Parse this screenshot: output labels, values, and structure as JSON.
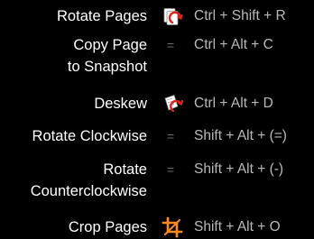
{
  "shortcuts": [
    {
      "label_lines": [
        "Rotate Pages"
      ],
      "icon": "rotate-pages-icon",
      "separator": "",
      "keys": "Ctrl + Shift + R"
    },
    {
      "label_lines": [
        "Copy Page",
        "to Snapshot"
      ],
      "icon": "",
      "separator": "=",
      "keys": "Ctrl + Alt + C"
    },
    {
      "label_lines": [
        "Deskew"
      ],
      "icon": "deskew-icon",
      "separator": "",
      "keys": "Ctrl + Alt + D"
    },
    {
      "label_lines": [
        "Rotate Clockwise"
      ],
      "icon": "",
      "separator": "=",
      "keys": "Shift + Alt + (=)"
    },
    {
      "label_lines": [
        "Rotate",
        "Counterclockwise"
      ],
      "icon": "",
      "separator": "=",
      "keys": "Shift + Alt + (-)"
    },
    {
      "label_lines": [
        "Crop Pages"
      ],
      "icon": "crop-pages-icon",
      "separator": "",
      "keys": "Shift + Alt + O"
    }
  ],
  "colors": {
    "background": "#000000",
    "label": "#ffffff",
    "shortcut": "#b9b9b9",
    "separator": "#6a6a6a",
    "icon_accent_red": "#e0201c",
    "crop_icon_orange": "#ff8a1f"
  }
}
